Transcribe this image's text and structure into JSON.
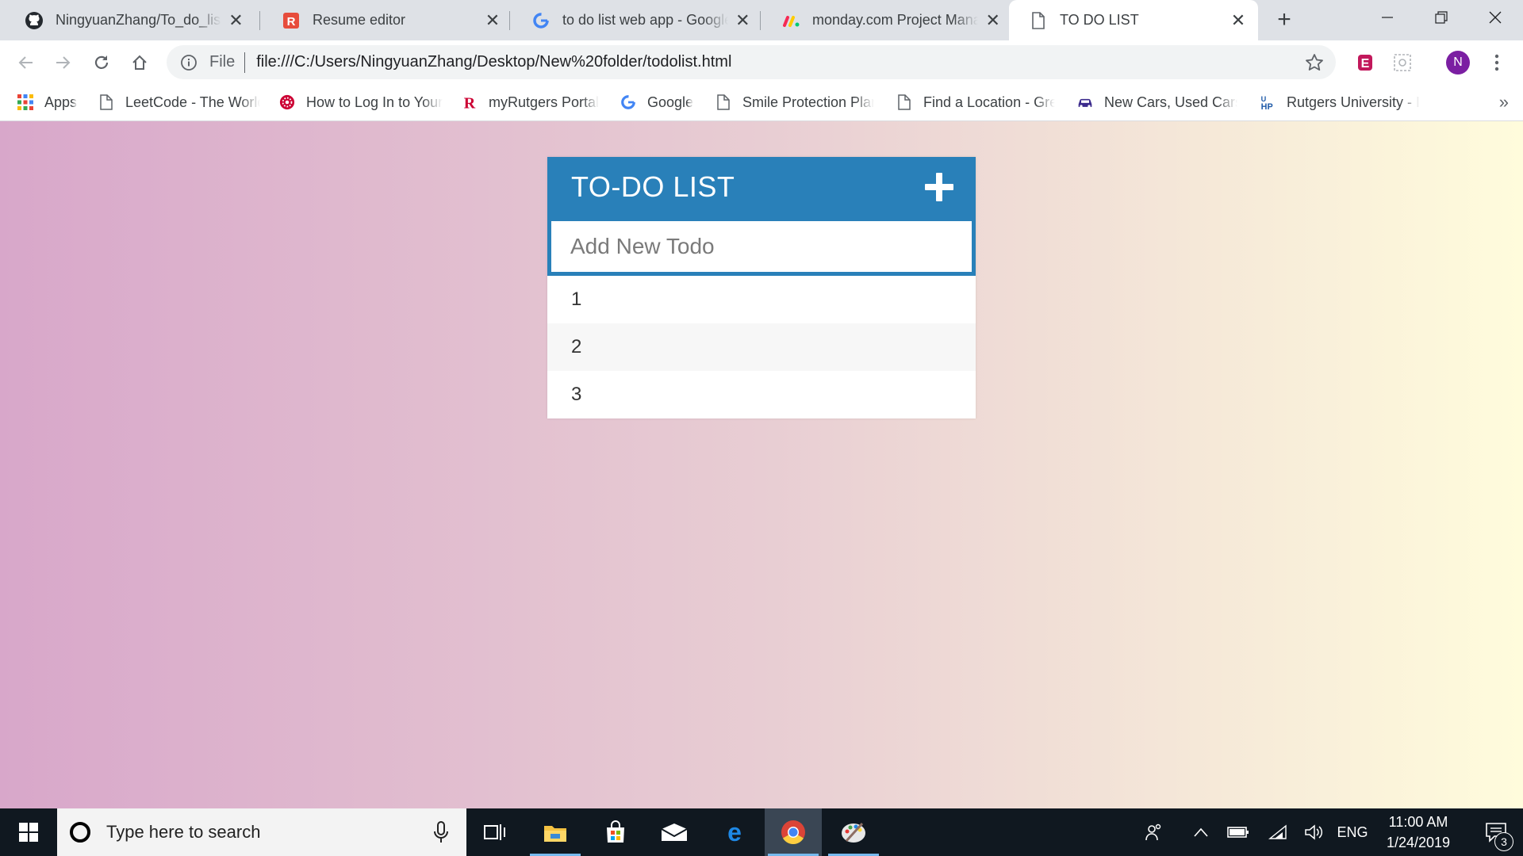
{
  "browser": {
    "tabs": [
      {
        "title": "NingyuanZhang/To_do_list:",
        "icon": "github-icon"
      },
      {
        "title": "Resume editor",
        "icon": "resume-r-icon"
      },
      {
        "title": "to do list web app - Google",
        "icon": "google-icon"
      },
      {
        "title": "monday.com Project Manag",
        "icon": "monday-icon"
      },
      {
        "title": "TO DO LIST",
        "icon": "file-icon",
        "active": true
      }
    ],
    "address": {
      "scheme": "File",
      "url": "file:///C:/Users/NingyuanZhang/Desktop/New%20folder/todolist.html"
    },
    "profile_initial": "N",
    "bookmarks": [
      {
        "label": "Apps",
        "icon": "apps-grid-icon"
      },
      {
        "label": "LeetCode - The World",
        "icon": "file-icon"
      },
      {
        "label": "How to Log In to Your",
        "icon": "rutgers-seal-icon"
      },
      {
        "label": "myRutgers Portal",
        "icon": "rutgers-r-icon"
      },
      {
        "label": "Google",
        "icon": "google-icon"
      },
      {
        "label": "Smile Protection Plan",
        "icon": "file-icon"
      },
      {
        "label": "Find a Location - Gre",
        "icon": "file-icon"
      },
      {
        "label": "New Cars, Used Cars,",
        "icon": "car-icon"
      },
      {
        "label": "Rutgers University - I",
        "icon": "hp-icon"
      }
    ]
  },
  "todo": {
    "title": "TO-DO LIST",
    "input_placeholder": "Add New Todo",
    "items": [
      "1",
      "2",
      "3"
    ]
  },
  "taskbar": {
    "search_placeholder": "Type here to search",
    "language": "ENG",
    "time": "11:00 AM",
    "date": "1/24/2019",
    "notification_count": "3"
  }
}
